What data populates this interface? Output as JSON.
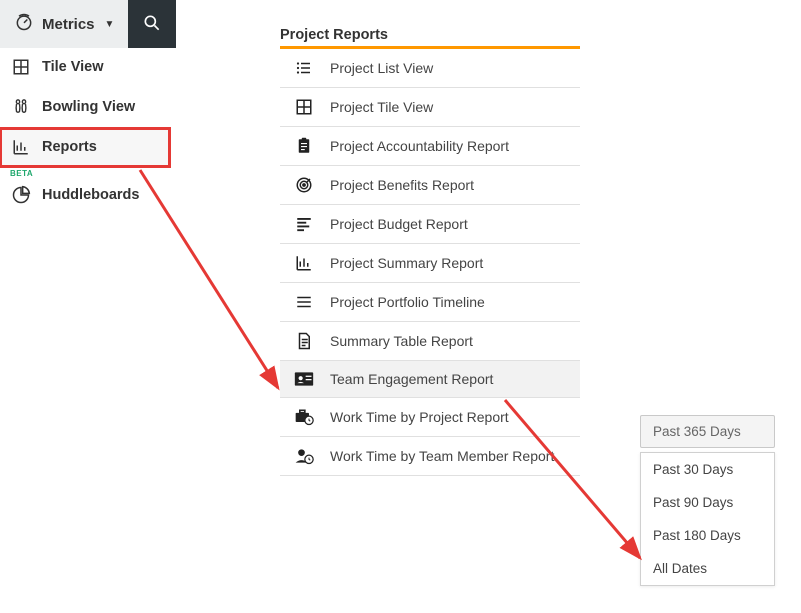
{
  "topbar": {
    "metrics_label": "Metrics"
  },
  "sidebar": {
    "items": [
      {
        "label": "Tile View"
      },
      {
        "label": "Bowling View"
      },
      {
        "label": "Reports"
      },
      {
        "label": "Huddleboards",
        "beta": "BETA"
      }
    ]
  },
  "section": {
    "header": "Project Reports"
  },
  "reports": [
    {
      "label": "Project List View"
    },
    {
      "label": "Project Tile View"
    },
    {
      "label": "Project Accountability Report"
    },
    {
      "label": "Project Benefits Report"
    },
    {
      "label": "Project Budget Report"
    },
    {
      "label": "Project Summary Report"
    },
    {
      "label": "Project Portfolio Timeline"
    },
    {
      "label": "Summary Table Report"
    },
    {
      "label": "Team Engagement Report"
    },
    {
      "label": "Work Time by Project Report"
    },
    {
      "label": "Work Time by Team Member Report"
    }
  ],
  "date_filter": {
    "selected": "Past 365 Days",
    "options": [
      "Past 30 Days",
      "Past 90 Days",
      "Past 180 Days",
      "All Dates"
    ]
  }
}
